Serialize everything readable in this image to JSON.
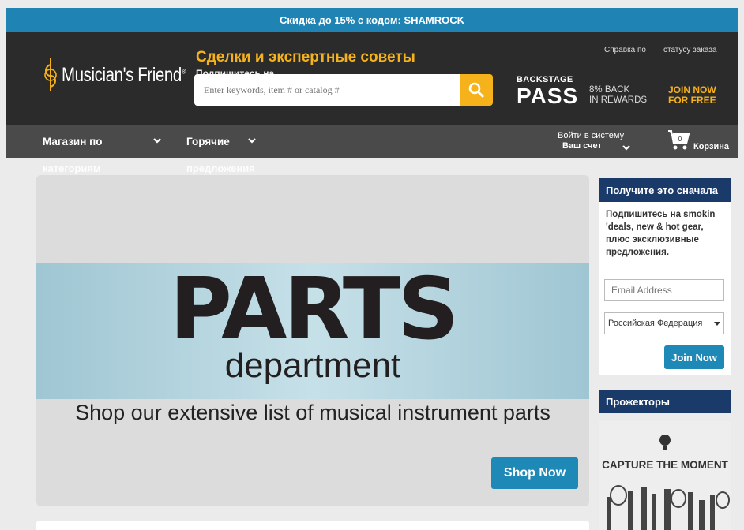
{
  "promo": {
    "text": "Скидка до 15% с кодом: SHAMROCK"
  },
  "header": {
    "logo_text": "Musician's Friend",
    "logo_reg": "®",
    "deals_title": "Сделки и экспертные советы",
    "deals_sub": "Подпишитесь на",
    "search_placeholder": "Enter keywords, item # or catalog #",
    "help_link": "Справка по",
    "status_link": "статусу заказа",
    "backstage_small": "BACKSTAGE",
    "backstage_big": "PASS",
    "rewards_line1": "8% BACK",
    "rewards_line2": "IN REWARDS",
    "join_line1": "JOIN NOW",
    "join_line2": "FOR FREE"
  },
  "nav": {
    "shop_line1": "Магазин по",
    "shop_line2": "категориям",
    "hot_line1": "Горячие",
    "hot_line2": "предложения",
    "login_line1": "Войти в систему",
    "login_line2": "Ваш счет",
    "cart_count": "0",
    "cart_label": "Корзина"
  },
  "hero": {
    "title": "PARTS",
    "subtitle": "department",
    "tagline": "Shop our extensive list of musical instrument parts",
    "cta": "Shop Now"
  },
  "signup": {
    "heading": "Получите это сначала",
    "description": "Подпишитесь на smokin 'deals, new & hot gear, плюс эксклюзивные предложения.",
    "email_placeholder": "Email Address",
    "country_value": "Российская Федерация",
    "join_label": "Join Now"
  },
  "spotlight": {
    "heading": "Прожекторы",
    "image_text": "CAPTURE THE MOMENT"
  },
  "colors": {
    "promo_blue": "#1f83b4",
    "header_dark": "#2b2b2b",
    "accent_yellow": "#f6b21b",
    "nav_gray": "#4a4a4a",
    "sidebar_navy": "#1a3a6a",
    "button_blue": "#1e88b6"
  },
  "icons": [
    "logo-mark-icon",
    "search-icon",
    "chevron-down-icon",
    "cart-icon",
    "select-arrow-icon"
  ]
}
